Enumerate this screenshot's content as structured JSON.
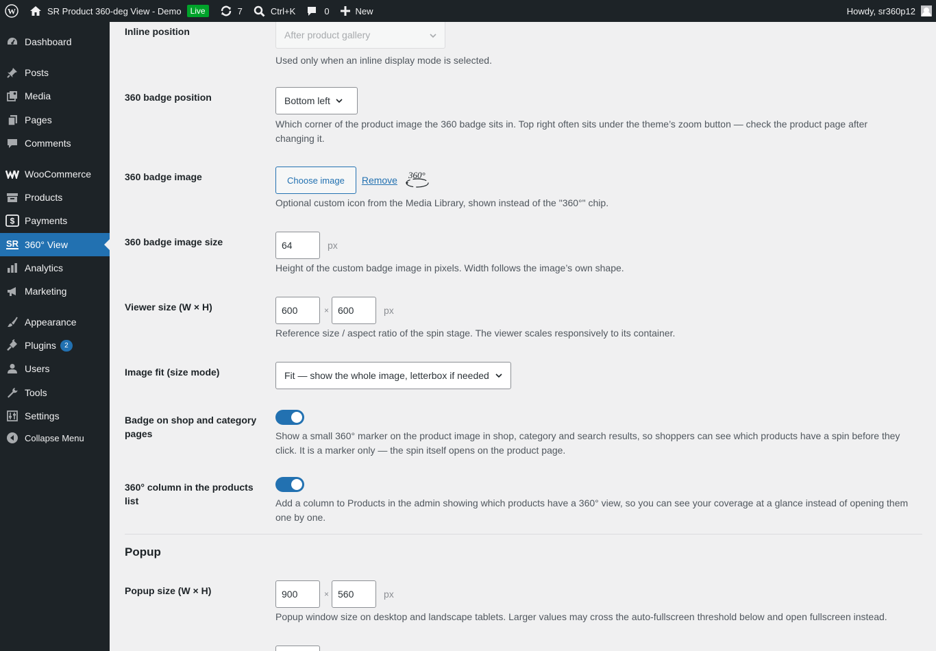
{
  "adminbar": {
    "site_name": "SR Product 360-deg View - Demo",
    "live_badge": "Live",
    "updates_count": "7",
    "search_shortcut": "Ctrl+K",
    "comments_count": "0",
    "new_label": "New",
    "howdy": "Howdy, sr360p12"
  },
  "sidebar": {
    "items": [
      {
        "label": "Dashboard",
        "icon": "dashboard-icon"
      },
      {
        "label": "Posts",
        "icon": "pin-icon"
      },
      {
        "label": "Media",
        "icon": "media-icon"
      },
      {
        "label": "Pages",
        "icon": "pages-icon"
      },
      {
        "label": "Comments",
        "icon": "comment-icon"
      },
      {
        "label": "WooCommerce",
        "icon": "woo-icon"
      },
      {
        "label": "Products",
        "icon": "archive-icon"
      },
      {
        "label": "Payments",
        "icon": "payments-icon"
      },
      {
        "label": "360° View",
        "icon": "sr-icon"
      },
      {
        "label": "Analytics",
        "icon": "chart-icon"
      },
      {
        "label": "Marketing",
        "icon": "megaphone-icon"
      },
      {
        "label": "Appearance",
        "icon": "brush-icon"
      },
      {
        "label": "Plugins",
        "icon": "plugin-icon",
        "badge": "2"
      },
      {
        "label": "Users",
        "icon": "users-icon"
      },
      {
        "label": "Tools",
        "icon": "wrench-icon"
      },
      {
        "label": "Settings",
        "icon": "settings-icon"
      },
      {
        "label": "Collapse Menu",
        "icon": "collapse-icon"
      }
    ]
  },
  "settings": {
    "inline_position": {
      "label": "Inline position",
      "value": "After product gallery",
      "desc": "Used only when an inline display mode is selected."
    },
    "badge_position": {
      "label": "360 badge position",
      "value": "Bottom left",
      "desc": "Which corner of the product image the 360 badge sits in. Top right often sits under the theme’s zoom button — check the product page after changing it."
    },
    "badge_image": {
      "label": "360 badge image",
      "choose": "Choose image",
      "remove": "Remove",
      "preview_text": "360°",
      "desc": "Optional custom icon from the Media Library, shown instead of the \"360°\" chip."
    },
    "badge_image_size": {
      "label": "360 badge image size",
      "value": "64",
      "unit": "px",
      "desc": "Height of the custom badge image in pixels. Width follows the image’s own shape."
    },
    "viewer_size": {
      "label": "Viewer size (W × H)",
      "width": "600",
      "height": "600",
      "times": "×",
      "unit": "px",
      "desc": "Reference size / aspect ratio of the spin stage. The viewer scales responsively to its container."
    },
    "image_fit": {
      "label": "Image fit (size mode)",
      "value": "Fit — show the whole image, letterbox if needed"
    },
    "shop_badge": {
      "label": "Badge on shop and category pages",
      "enabled": true,
      "desc": "Show a small 360° marker on the product image in shop, category and search results, so shoppers can see which products have a spin before they click. It is a marker only — the spin itself opens on the product page."
    },
    "products_column": {
      "label": "360° column in the products list",
      "enabled": true,
      "desc": "Add a column to Products in the admin showing which products have a 360° view, so you can see your coverage at a glance instead of opening them one by one."
    },
    "popup_section": "Popup",
    "popup_size": {
      "label": "Popup size (W × H)",
      "width": "900",
      "height": "560",
      "times": "×",
      "unit": "px",
      "desc": "Popup window size on desktop and landscape tablets. Larger values may cross the auto-fullscreen threshold below and open fullscreen instead."
    }
  },
  "colors": {
    "accent": "#2271b1",
    "adminbar": "#1d2327",
    "live": "#00a32a"
  }
}
